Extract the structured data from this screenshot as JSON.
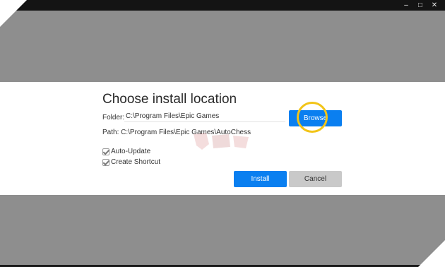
{
  "window": {
    "controls": {
      "minimize": "–",
      "maximize": "□",
      "close": "✕"
    }
  },
  "dialog": {
    "title": "Choose install location",
    "folder": {
      "label": "Folder:",
      "value": "C:\\Program Files\\Epic Games"
    },
    "path": {
      "label": "Path:",
      "value": "C:\\Program Files\\Epic Games\\AutoChess"
    },
    "browse_button": "Browse",
    "options": [
      {
        "label": "Auto-Update",
        "checked": true
      },
      {
        "label": "Create Shortcut",
        "checked": true
      }
    ],
    "install_button": "Install",
    "cancel_button": "Cancel"
  },
  "colors": {
    "accent": "#0a7ff0",
    "highlight_ring": "#f2c418",
    "overlay": "#8e8e8e",
    "titlebar": "#141414",
    "cancel": "#c9c9c9"
  },
  "icons": [
    "minimize-icon",
    "maximize-icon",
    "close-icon",
    "checkbox-checked-icon"
  ]
}
